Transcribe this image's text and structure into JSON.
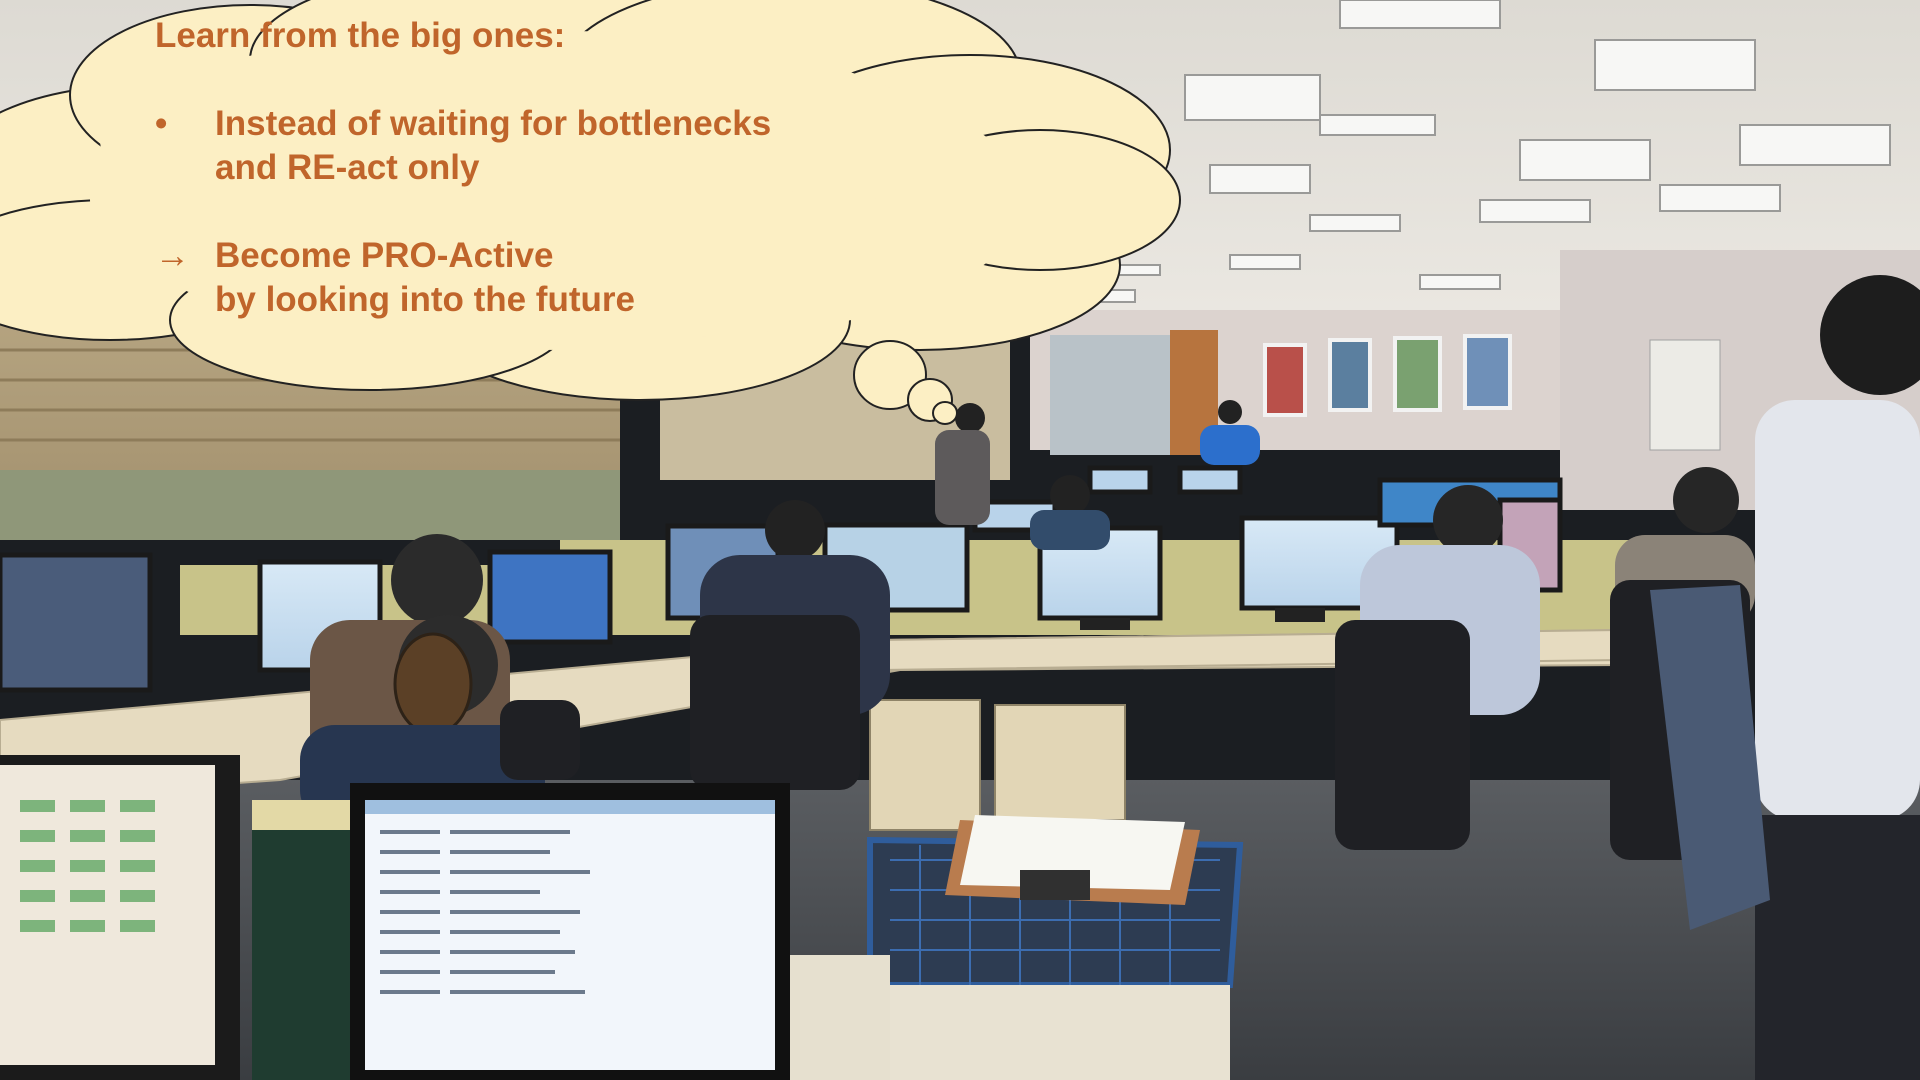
{
  "slide": {
    "thought_bubble": {
      "heading": "Learn from the big ones:",
      "bullet_marker": "•",
      "bullet_line1": "Instead of waiting for bottlenecks",
      "bullet_line2": "and RE-act only",
      "arrow_marker": "→",
      "arrow_line1": "Become PRO-Active",
      "arrow_line2": "by looking into the future"
    }
  },
  "photo": {
    "subject": "open-plan office control room with rows of computer workstations",
    "colors": {
      "ceiling": "#e6e4df",
      "wall": "#d9d1cc",
      "desk": "#e7dcc0",
      "partition": "#c9c48a",
      "floor": "#4a4e54",
      "bubble_fill": "#fcefc4",
      "text_accent": "#c0652b"
    }
  }
}
